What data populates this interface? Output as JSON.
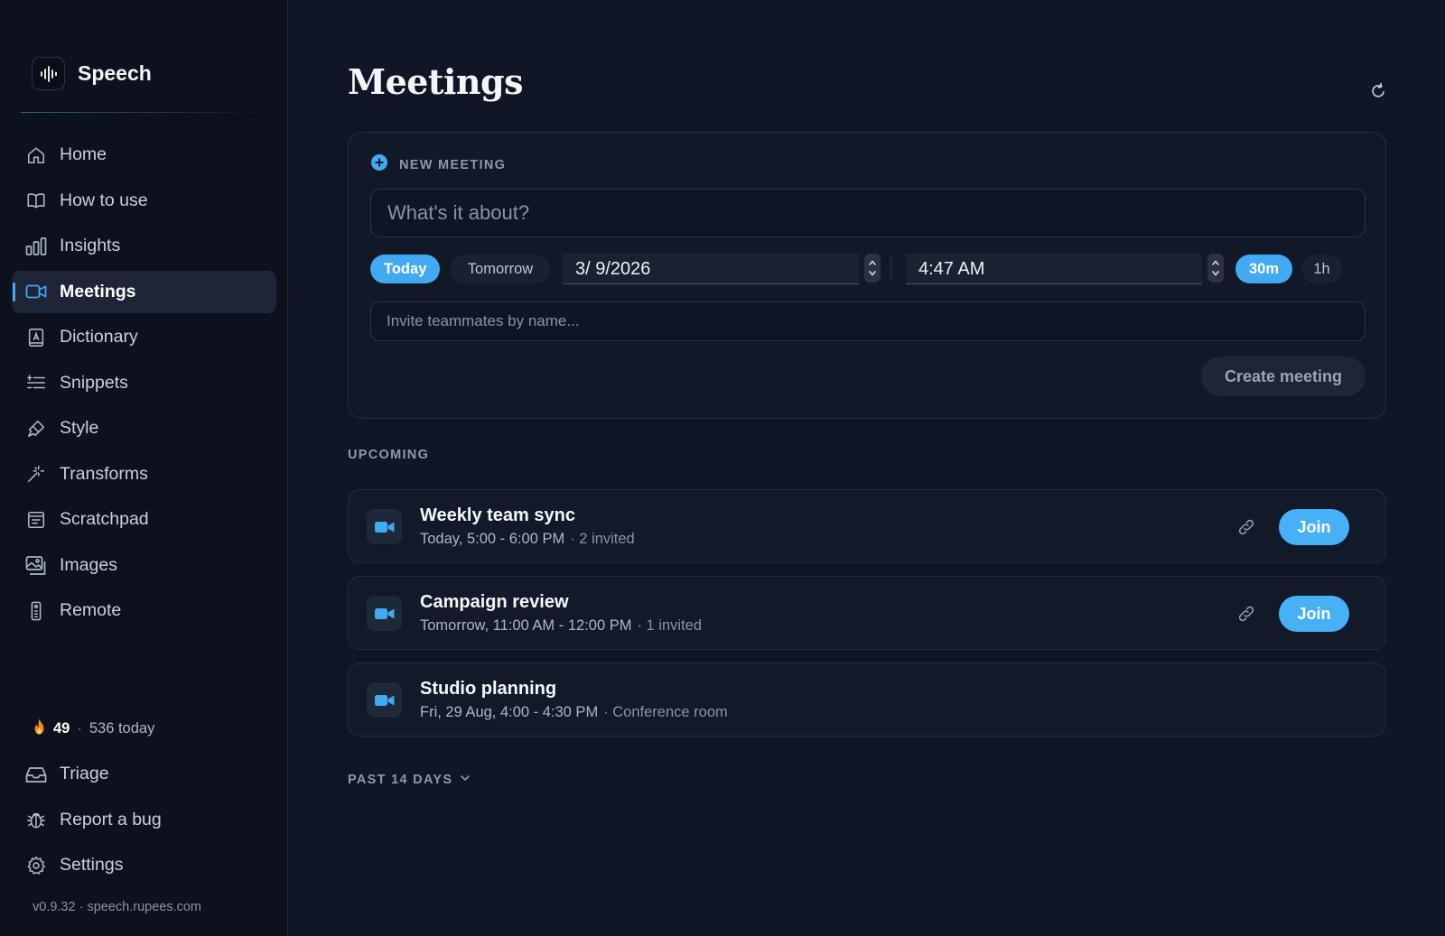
{
  "app": {
    "name": "Speech"
  },
  "sidebar": {
    "items": [
      {
        "label": "Home",
        "icon": "home-icon"
      },
      {
        "label": "How to use",
        "icon": "book-icon"
      },
      {
        "label": "Insights",
        "icon": "bar-chart-icon"
      },
      {
        "label": "Meetings",
        "icon": "video-camera-icon",
        "active": true
      },
      {
        "label": "Dictionary",
        "icon": "dictionary-icon"
      },
      {
        "label": "Snippets",
        "icon": "snippets-icon"
      },
      {
        "label": "Style",
        "icon": "brush-icon"
      },
      {
        "label": "Transforms",
        "icon": "magic-wand-icon"
      },
      {
        "label": "Scratchpad",
        "icon": "notepad-icon"
      },
      {
        "label": "Images",
        "icon": "images-icon"
      },
      {
        "label": "Remote",
        "icon": "remote-icon"
      }
    ],
    "streak": {
      "count": "49",
      "separator": "·",
      "today": "536 today"
    },
    "bottom_items": [
      {
        "label": "Triage",
        "icon": "inbox-icon"
      },
      {
        "label": "Report a bug",
        "icon": "bug-icon"
      },
      {
        "label": "Settings",
        "icon": "gear-icon"
      }
    ],
    "version": "v0.9.32 · speech.rupees.com"
  },
  "main": {
    "title": "Meetings",
    "new_meeting": {
      "heading": "NEW MEETING",
      "about_placeholder": "What's it about?",
      "day_options": [
        "Today",
        "Tomorrow"
      ],
      "selected_day": "Today",
      "date_value": "3/  9/2026",
      "time_value": "4:47 AM",
      "duration_options": [
        "30m",
        "1h"
      ],
      "selected_duration": "30m",
      "invite_placeholder": "Invite teammates by name...",
      "create_label": "Create meeting"
    },
    "upcoming_label": "UPCOMING",
    "meetings": [
      {
        "title": "Weekly team sync",
        "when": "Today, 5:00 - 6:00 PM",
        "extra": "· 2 invited",
        "join_label": "Join"
      },
      {
        "title": "Campaign review",
        "when": "Tomorrow, 11:00 AM - 12:00 PM",
        "extra": "· 1 invited",
        "join_label": "Join"
      },
      {
        "title": "Studio planning",
        "when": "Fri, 29 Aug, 4:00 - 4:30 PM",
        "extra": "· Conference room"
      }
    ],
    "past_label": "PAST 14 DAYS"
  },
  "colors": {
    "accent": "#43a9f1",
    "background": "#101626",
    "sidebar": "#0c111d",
    "streak_fire": "#f08a24"
  }
}
